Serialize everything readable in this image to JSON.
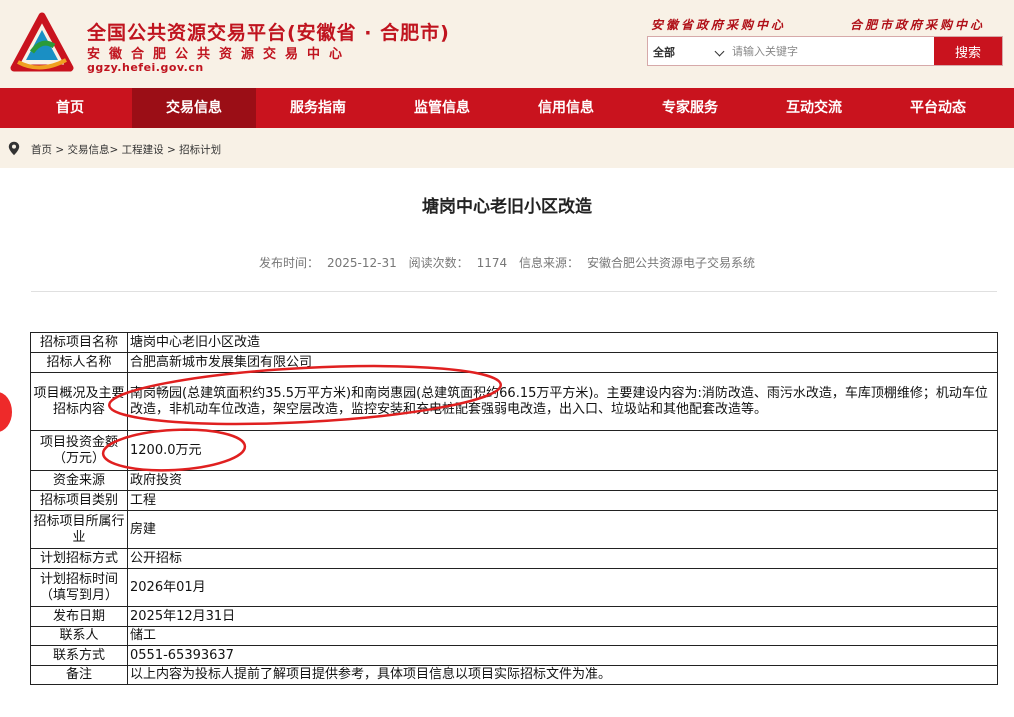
{
  "header": {
    "title": "全国公共资源交易平台(安徽省 · 合肥市)",
    "subtitle": "安徽合肥公共资源交易中心",
    "url": "ggzy.hefei.gov.cn",
    "top_link_1": "安徽省政府采购中心",
    "top_link_2": "合肥市政府采购中心",
    "search": {
      "category": "全部",
      "placeholder": "请输入关键字",
      "button": "搜索"
    },
    "brand_color": "#c9131e"
  },
  "nav": {
    "items": [
      {
        "label": "首页"
      },
      {
        "label": "交易信息",
        "active": true
      },
      {
        "label": "服务指南"
      },
      {
        "label": "监管信息"
      },
      {
        "label": "信用信息"
      },
      {
        "label": "专家服务"
      },
      {
        "label": "互动交流"
      },
      {
        "label": "平台动态"
      }
    ]
  },
  "breadcrumb": {
    "text": "首页 > 交易信息> 工程建设 > 招标计划"
  },
  "article": {
    "title": "塘岗中心老旧小区改造",
    "meta": {
      "publish_label": "发布时间：",
      "publish_date": "2025-12-31",
      "views_label": "阅读次数：",
      "views": "1174",
      "source_label": "信息来源：",
      "source": "安徽合肥公共资源电子交易系统"
    }
  },
  "table": {
    "rows": [
      {
        "key": "招标项目名称",
        "value": "塘岗中心老旧小区改造"
      },
      {
        "key": "招标人名称",
        "value": "合肥高新城市发展集团有限公司"
      },
      {
        "key": "项目概况及主要招标内容",
        "value": "南岗畅园(总建筑面积约35.5万平方米)和南岗惠园(总建筑面积约66.15万平方米)。主要建设内容为:消防改造、雨污水改造，车库顶棚维修；机动车位改造，非机动车位改造，架空层改造，监控安装和充电桩配套强弱电改造，出入口、垃圾站和其他配套改造等。"
      },
      {
        "key": "项目投资金额（万元）",
        "value": "1200.0万元"
      },
      {
        "key": "资金来源",
        "value": "政府投资"
      },
      {
        "key": "招标项目类别",
        "value": "工程"
      },
      {
        "key": "招标项目所属行业",
        "value": "房建"
      },
      {
        "key": "计划招标方式",
        "value": "公开招标"
      },
      {
        "key": "计划招标时间（填写到月）",
        "value": "2026年01月"
      },
      {
        "key": "发布日期",
        "value": "2025年12月31日"
      },
      {
        "key": "联系人",
        "value": "储工"
      },
      {
        "key": "联系方式",
        "value": "0551-65393637"
      },
      {
        "key": "备注",
        "value": "以上内容为投标人提前了解项目提供参考，具体项目信息以项目实际招标文件为准。"
      }
    ]
  },
  "annotation_color": "#e02020"
}
